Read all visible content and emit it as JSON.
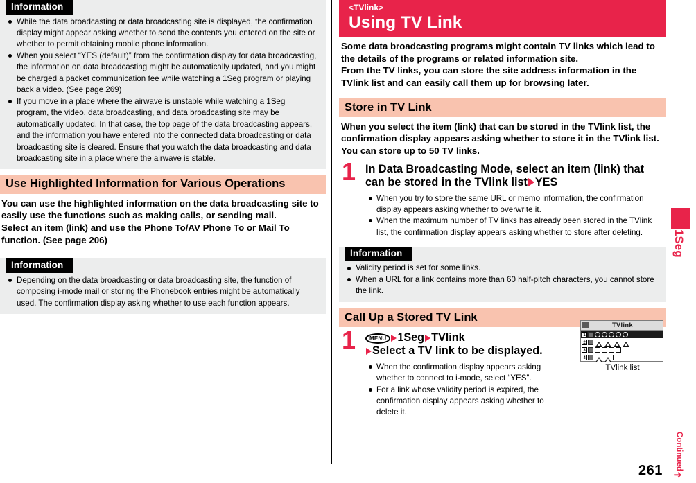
{
  "page": {
    "number": "261",
    "continued_label": "Continued",
    "side_tab_label": "1Seg"
  },
  "left_column": {
    "info_box_1": {
      "label": "Information",
      "items": [
        "While the data broadcasting or data broadcasting site is displayed, the confirmation display might appear asking whether to send the contents you entered on the site or whether to permit obtaining mobile phone information.",
        "When you select “YES (default)” from the confirmation display for data broadcasting, the information on data broadcasting might be automatically updated, and you might be charged a packet communication fee while watching a 1Seg program or playing back a video. (See page 269)",
        "If you move in a place where the airwave is unstable while watching a 1Seg program, the video, data broadcasting, and data broadcasting site may be automatically updated. In that case, the top page of the data broadcasting appears, and the information you have entered into the connected data broadcasting or data broadcasting site is cleared. Ensure that you watch the data broadcasting and data broadcasting site in a place where the airwave is stable."
      ]
    },
    "section_header": "Use Highlighted Information for Various Operations",
    "lead_paragraph": "You can use the highlighted information on the data broadcasting site to easily use the functions such as making calls, or sending mail.\nSelect an item (link) and use the Phone To/AV Phone To or Mail To function. (See page 206)",
    "info_box_2": {
      "label": "Information",
      "items": [
        "Depending on the data broadcasting or data broadcasting site, the function of composing i-mode mail or storing the Phonebook entries might be automatically used. The confirmation display asking whether to use each function appears."
      ]
    }
  },
  "right_column": {
    "banner": {
      "subtitle": "<TVlink>",
      "title": "Using TV Link"
    },
    "lead_paragraph": "Some data broadcasting programs might contain TV links which lead to the details of the programs or related information site.\nFrom the TV links, you can store the site address information in the TVlink list and can easily call them up for browsing later.",
    "section_1": {
      "header": "Store in TV Link",
      "lead": "When you select the item (link) that can be stored in the TVlink list, the confirmation display appears asking whether to store it in the TVlink list.\nYou can store up to 50 TV links.",
      "step": {
        "number": "1",
        "title_part1": "In Data Broadcasting Mode, select an item (link) that can be stored in the TVlink list",
        "title_part2": "YES",
        "notes": [
          "When you try to store the same URL or memo information, the confirmation display appears asking whether to overwrite it.",
          "When the maximum number of TV links has already been stored in the TVlink list, the confirmation display appears asking whether to store after deleting."
        ]
      },
      "info_box": {
        "label": "Information",
        "items": [
          "Validity period is set for some links.",
          "When a URL for a link contains more than 60 half-pitch characters, you cannot store the link."
        ]
      }
    },
    "section_2": {
      "header": "Call Up a Stored TV Link",
      "step": {
        "number": "1",
        "key_label": "MENU",
        "title_seg1": "1Seg",
        "title_seg2": "TVlink",
        "title_line2": "Select a TV link to be displayed.",
        "notes": [
          "When the confirmation display appears asking whether to connect to i-mode, select “YES”.",
          "For a link whose validity period is expired, the confirmation display appears asking whether to delete it."
        ]
      },
      "figure": {
        "screen_title": "TVlink",
        "rows": [
          {
            "index": "1",
            "shapes": [
              "circle",
              "circle",
              "circle",
              "circle",
              "circle"
            ],
            "selected": true
          },
          {
            "index": "2",
            "shapes": [
              "tri",
              "tri",
              "tri",
              "tri"
            ],
            "selected": false
          },
          {
            "index": "3",
            "shapes": [
              "sq",
              "sq",
              "sq",
              "sq"
            ],
            "selected": false
          },
          {
            "index": "4",
            "shapes": [
              "tri",
              "tri",
              "sq",
              "sq"
            ],
            "selected": false
          }
        ],
        "caption": "TVlink list"
      }
    }
  },
  "colors": {
    "accent_red": "#e8234a",
    "header_pink": "#f9c3af",
    "info_gray": "#eceded"
  }
}
